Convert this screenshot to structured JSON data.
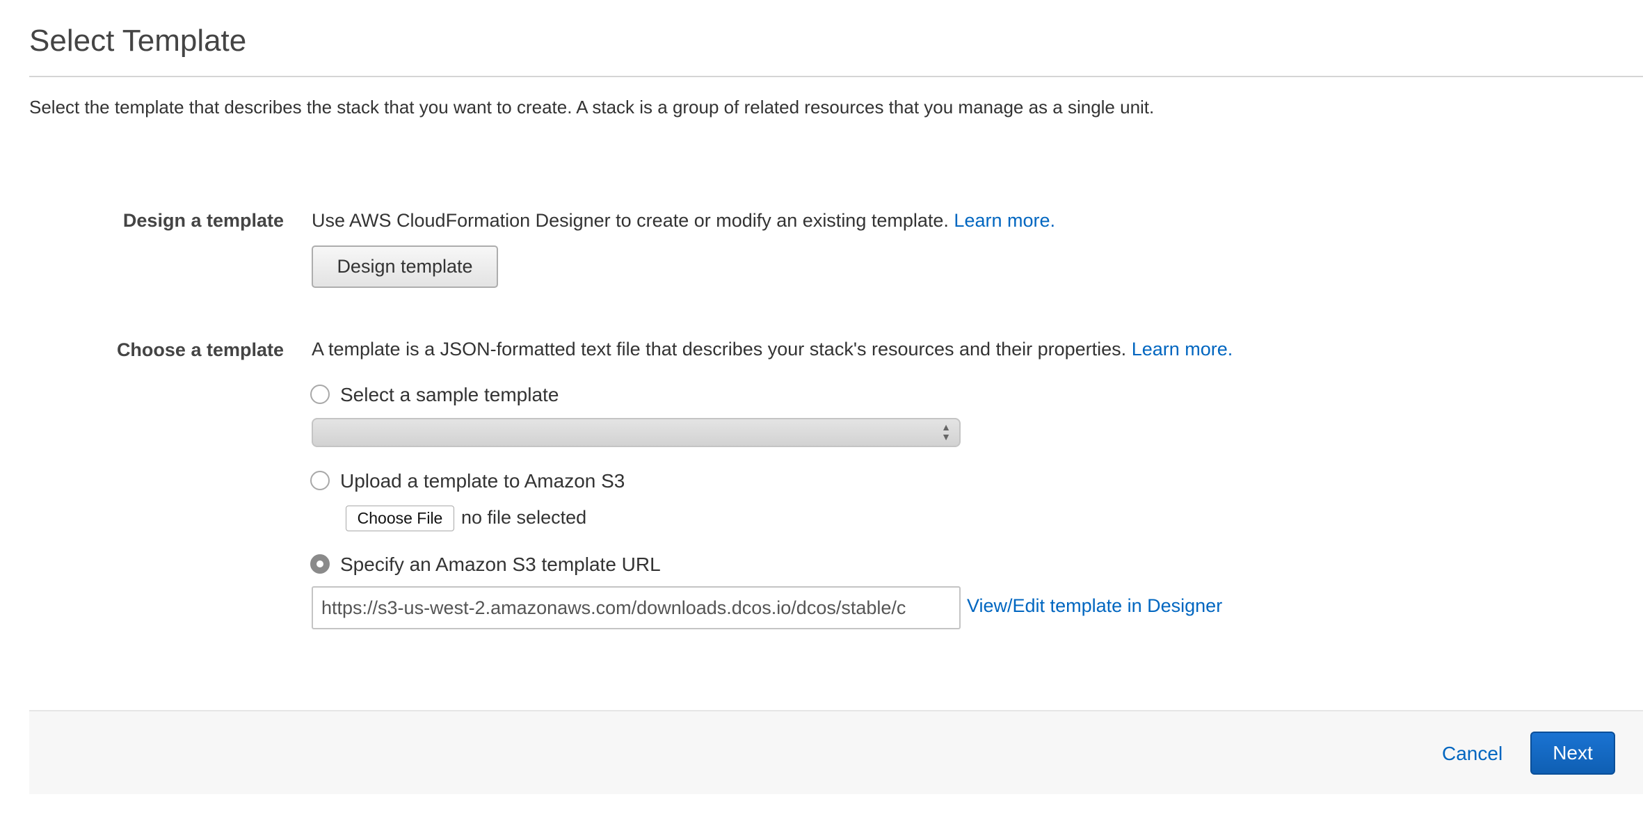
{
  "header": {
    "title": "Select Template",
    "intro": "Select the template that describes the stack that you want to create. A stack is a group of related resources that you manage as a single unit."
  },
  "design": {
    "label": "Design a template",
    "description": "Use AWS CloudFormation Designer to create or modify an existing template.",
    "learn_more": "Learn more.",
    "button": "Design template"
  },
  "choose": {
    "label": "Choose a template",
    "description": "A template is a JSON-formatted text file that describes your stack's resources and their properties.",
    "learn_more": "Learn more.",
    "options": {
      "sample": {
        "label": "Select a sample template",
        "selected": false,
        "select_value": ""
      },
      "upload": {
        "label": "Upload a template to Amazon S3",
        "selected": false,
        "file_button": "Choose File",
        "file_status": "no file selected"
      },
      "url": {
        "label": "Specify an Amazon S3 template URL",
        "selected": true,
        "value": "https://s3-us-west-2.amazonaws.com/downloads.dcos.io/dcos/stable/c",
        "designer_link": "View/Edit template in Designer"
      }
    }
  },
  "footer": {
    "cancel": "Cancel",
    "next": "Next"
  },
  "colors": {
    "link": "#0066c0",
    "primary_button": "#1a73d2",
    "footer_bg": "#f7f7f7"
  },
  "icons": {
    "select_arrows": "updown-arrows-icon"
  }
}
